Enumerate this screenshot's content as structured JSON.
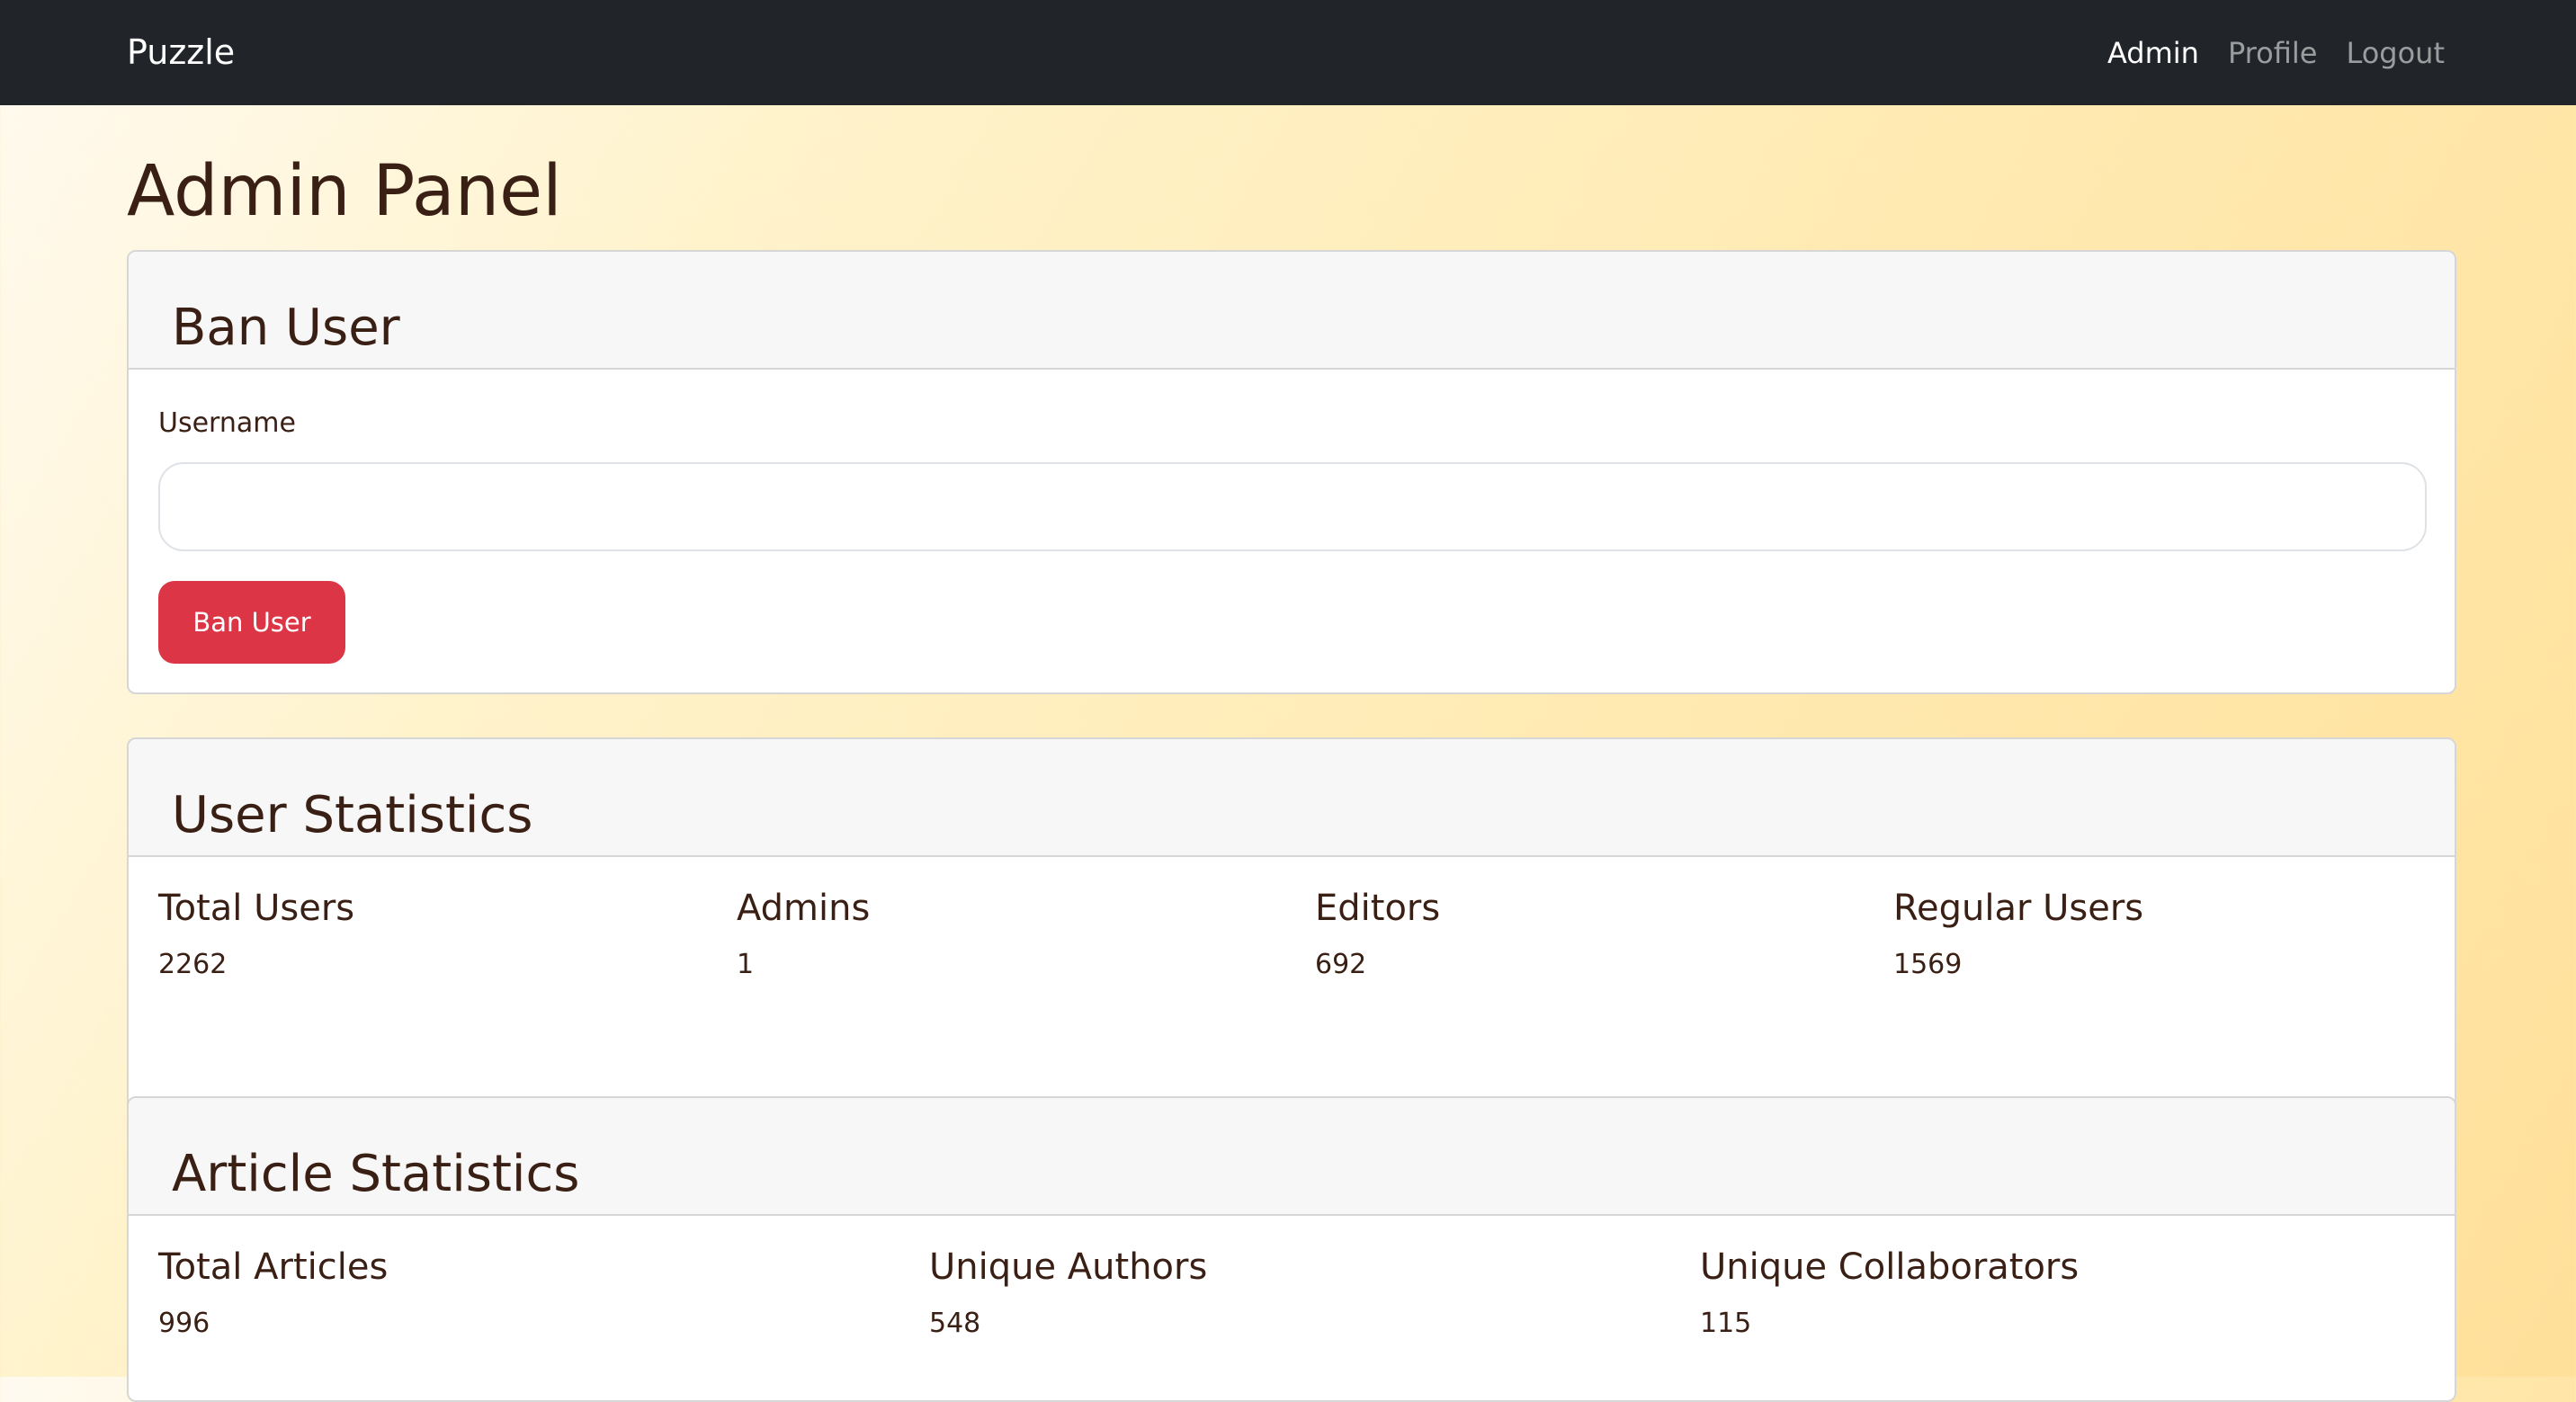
{
  "navbar": {
    "brand": "Puzzle",
    "links": [
      {
        "label": "Admin",
        "active": true
      },
      {
        "label": "Profile",
        "active": false
      },
      {
        "label": "Logout",
        "active": false
      }
    ]
  },
  "page": {
    "title": "Admin Panel"
  },
  "ban_user": {
    "header": "Ban User",
    "username_label": "Username",
    "username_value": "",
    "button_label": "Ban User",
    "button_color": "#dc3545"
  },
  "user_statistics": {
    "header": "User Statistics",
    "items": [
      {
        "label": "Total Users",
        "value": "2262"
      },
      {
        "label": "Admins",
        "value": "1"
      },
      {
        "label": "Editors",
        "value": "692"
      },
      {
        "label": "Regular Users",
        "value": "1569"
      }
    ]
  },
  "article_statistics": {
    "header": "Article Statistics",
    "items": [
      {
        "label": "Total Articles",
        "value": "996"
      },
      {
        "label": "Unique Authors",
        "value": "548"
      },
      {
        "label": "Unique Collaborators",
        "value": "115"
      }
    ]
  }
}
